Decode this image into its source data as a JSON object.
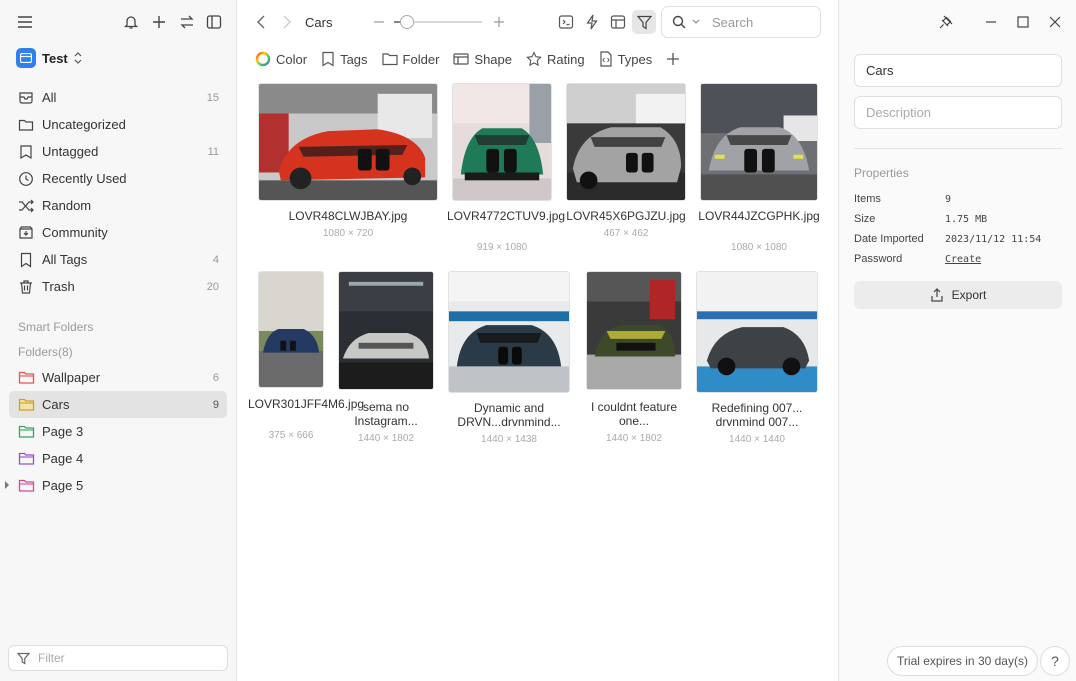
{
  "sidebar": {
    "library_name": "Test",
    "nav": [
      {
        "label": "All",
        "count": "15",
        "icon": "all-items-icon"
      },
      {
        "label": "Uncategorized",
        "count": "",
        "icon": "uncategorized-icon"
      },
      {
        "label": "Untagged",
        "count": "11",
        "icon": "untagged-icon"
      },
      {
        "label": "Recently Used",
        "count": "",
        "icon": "clock-icon"
      },
      {
        "label": "Random",
        "count": "",
        "icon": "shuffle-icon"
      },
      {
        "label": "Community",
        "count": "",
        "icon": "community-icon"
      },
      {
        "label": "All Tags",
        "count": "4",
        "icon": "tag-icon"
      },
      {
        "label": "Trash",
        "count": "20",
        "icon": "trash-icon"
      }
    ],
    "smart_folders_label": "Smart Folders",
    "folders_label": "Folders(8)",
    "folders": [
      {
        "label": "Wallpaper",
        "count": "6",
        "color": "#e05555"
      },
      {
        "label": "Cars",
        "count": "9",
        "color": "#c9a227"
      },
      {
        "label": "Page 3",
        "count": "",
        "color": "#3aa360"
      },
      {
        "label": "Page 4",
        "count": "",
        "color": "#9b4fc9"
      },
      {
        "label": "Page 5",
        "count": "",
        "color": "#d44a9a"
      }
    ],
    "filter_placeholder": "Filter"
  },
  "toolbar": {
    "breadcrumb": "Cars",
    "zoom_level": 0.15,
    "search_placeholder": "Search"
  },
  "filterbar": {
    "color": "Color",
    "tags": "Tags",
    "folder": "Folder",
    "shape": "Shape",
    "rating": "Rating",
    "types": "Types"
  },
  "items": [
    {
      "name": "LOVR48CLWJBAY.jpg",
      "dim": "1080 × 720"
    },
    {
      "name": "LOVR4772CTUV9.jpg",
      "dim": "919 × 1080"
    },
    {
      "name": "LOVR45X6PGJZU.jpg",
      "dim": "467 × 462"
    },
    {
      "name": "LOVR44JZCGPHK.jpg",
      "dim": "1080 × 1080"
    },
    {
      "name": "LOVR301JFF4M6.jpg",
      "dim": "375 × 666"
    },
    {
      "name": "sema no Instagram...",
      "dim": "1440 × 1802"
    },
    {
      "name": "Dynamic and DRVN...drvnmind...",
      "dim": "1440 × 1438"
    },
    {
      "name": "I couldnt feature one...",
      "dim": "1440 × 1802"
    },
    {
      "name": "Redefining 007... drvnmind 007...",
      "dim": "1440 × 1440"
    }
  ],
  "inspector": {
    "name_value": "Cars",
    "description_placeholder": "Description",
    "properties_title": "Properties",
    "props": {
      "items_label": "Items",
      "items_value": "9",
      "size_label": "Size",
      "size_value": "1.75 MB",
      "date_label": "Date Imported",
      "date_value": "2023/11/12 11:54",
      "password_label": "Password",
      "password_value": "Create"
    },
    "export_label": "Export",
    "trial_text": "Trial expires in 30 day(s)",
    "help_label": "?"
  }
}
